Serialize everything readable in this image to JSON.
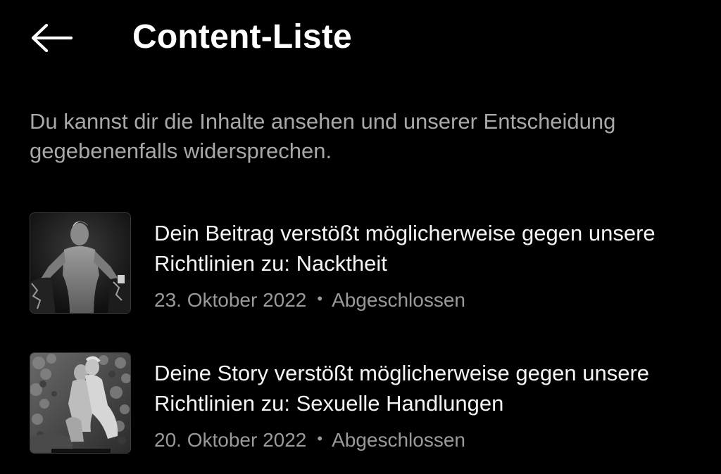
{
  "header": {
    "title": "Content-Liste",
    "back_icon": "arrow-left-icon"
  },
  "intro_text": "Du kannst dir die Inhalte ansehen und unserer Entscheidung gegebenenfalls widersprechen.",
  "items": [
    {
      "title": "Dein Beitrag verstößt möglicherweise gegen unsere Richtlinien zu: Nacktheit",
      "date": "23. Oktober 2022",
      "separator": "•",
      "status": "Abgeschlossen"
    },
    {
      "title": "Deine Story verstößt möglicherweise gegen unsere Richtlinien zu: Sexuelle Handlungen",
      "date": "20. Oktober 2022",
      "separator": "•",
      "status": "Abgeschlossen"
    }
  ],
  "colors": {
    "background": "#000000",
    "primary_text": "#ffffff",
    "secondary_text": "#a8a8a8"
  }
}
